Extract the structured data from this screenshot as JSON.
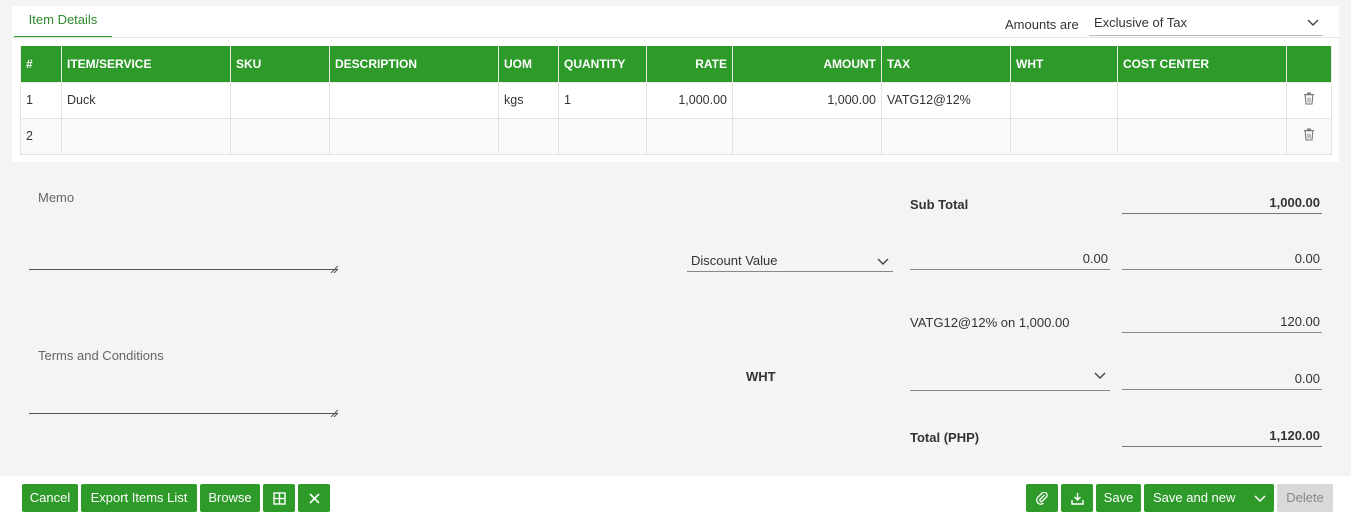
{
  "tabs": {
    "item_details": "Item Details"
  },
  "amounts": {
    "label": "Amounts are",
    "value": "Exclusive of Tax"
  },
  "table": {
    "headers": [
      "#",
      "ITEM/SERVICE",
      "SKU",
      "DESCRIPTION",
      "UOM",
      "QUANTITY",
      "RATE",
      "AMOUNT",
      "TAX",
      "WHT",
      "COST CENTER",
      ""
    ],
    "rows": [
      {
        "num": "1",
        "item": "Duck",
        "sku": "",
        "description": "",
        "uom": "kgs",
        "quantity": "1",
        "rate": "1,000.00",
        "amount": "1,000.00",
        "tax": "VATG12@12%",
        "wht": "",
        "cost_center": "",
        "delete_icon": "trash-icon"
      },
      {
        "num": "2",
        "item": "",
        "sku": "",
        "description": "",
        "uom": "",
        "quantity": "",
        "rate": "",
        "amount": "",
        "tax": "",
        "wht": "",
        "cost_center": "",
        "delete_icon": "trash-icon"
      }
    ]
  },
  "memo": {
    "label": "Memo",
    "value": ""
  },
  "terms": {
    "label": "Terms and Conditions",
    "value": ""
  },
  "totals": {
    "subtotal_label": "Sub Total",
    "subtotal_value": "1,000.00",
    "discount_type": "Discount Value",
    "discount_input": "0.00",
    "discount_amount": "0.00",
    "tax_line_label": "VATG12@12% on 1,000.00",
    "tax_line_value": "120.00",
    "wht_label": "WHT",
    "wht_select": "",
    "wht_value": "0.00",
    "total_label": "Total (PHP)",
    "total_value": "1,120.00"
  },
  "footer": {
    "cancel": "Cancel",
    "export": "Export Items List",
    "browse": "Browse",
    "grid_icon": "grid-icon",
    "close_icon": "close-icon",
    "attach_icon": "paperclip-icon",
    "download_icon": "download-icon",
    "save": "Save",
    "save_new": "Save and new",
    "delete": "Delete"
  },
  "colors": {
    "accent": "#2e9a2a",
    "disabled": "#d9d9d9"
  }
}
